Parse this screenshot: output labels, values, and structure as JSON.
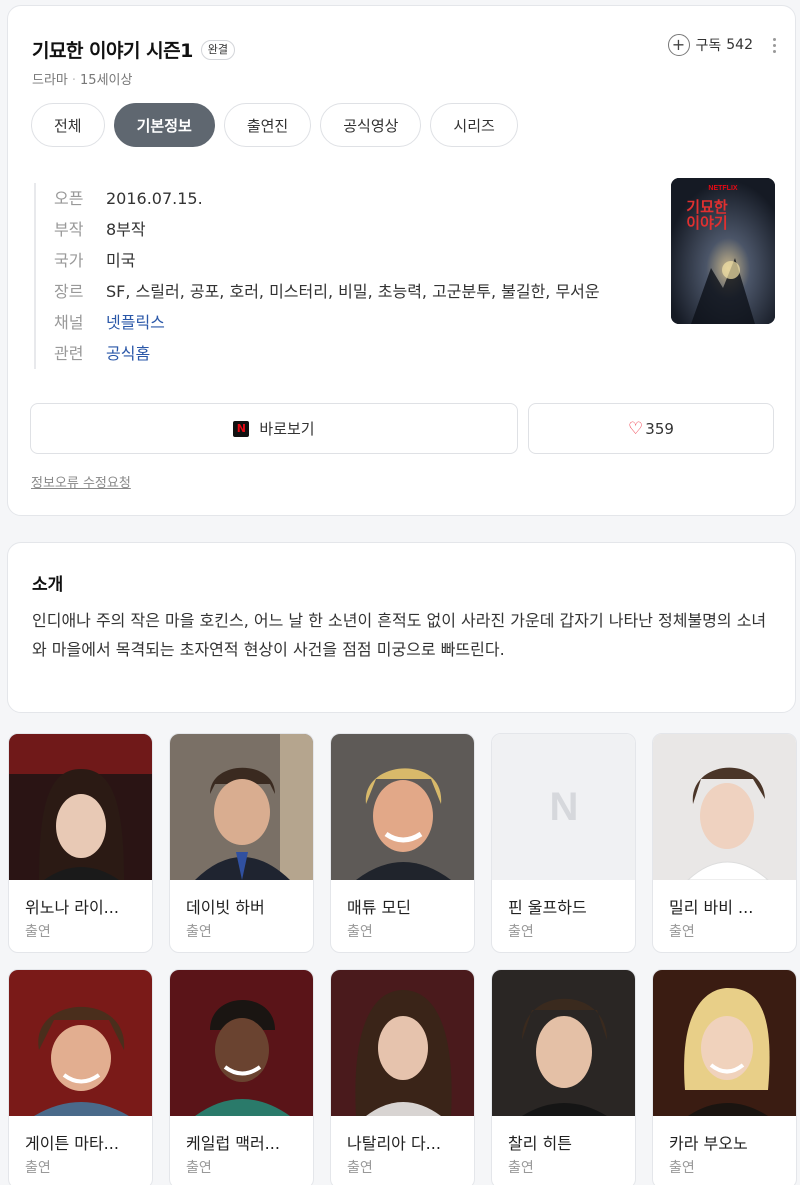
{
  "header": {
    "title": "기묘한 이야기 시즌1",
    "badge": "완결",
    "genre": "드라마",
    "rating": "15세이상",
    "subscribe_label": "구독",
    "subscribe_count": "542"
  },
  "tabs": [
    {
      "label": "전체",
      "active": false
    },
    {
      "label": "기본정보",
      "active": true
    },
    {
      "label": "출연진",
      "active": false
    },
    {
      "label": "공식영상",
      "active": false
    },
    {
      "label": "시리즈",
      "active": false
    }
  ],
  "info": [
    {
      "key": "오픈",
      "value": "2016.07.15."
    },
    {
      "key": "부작",
      "value": "8부작"
    },
    {
      "key": "국가",
      "value": "미국"
    },
    {
      "key": "장르",
      "value": "SF, 스릴러, 공포, 호러, 미스터리, 비밀, 초능력, 고군분투, 불길한, 무서운"
    },
    {
      "key": "채널",
      "value": "넷플릭스"
    },
    {
      "key": "관련",
      "value": "공식홈"
    }
  ],
  "poster": {
    "badge": "NETFLIX",
    "title_line1": "기묘한",
    "title_line2": "이야기"
  },
  "actions": {
    "watch_label": "바로보기",
    "netflix_icon": "N",
    "like_count": "359"
  },
  "report_link": "정보오류 수정요청",
  "intro": {
    "title": "소개",
    "text": "인디애나 주의 작은 마을 호킨스, 어느 날 한 소년이 흔적도 없이 사라진 가운데 갑자기 나타난 정체불명의 소녀와 마을에서 목격되는 초자연적 현상이 사건을 점점 미궁으로 빠뜨린다."
  },
  "cast": [
    {
      "name": "위노나 라이...",
      "role": "출연"
    },
    {
      "name": "데이빗 하버",
      "role": "출연"
    },
    {
      "name": "매튜 모딘",
      "role": "출연"
    },
    {
      "name": "핀 울프하드",
      "role": "출연"
    },
    {
      "name": "밀리 바비 ...",
      "role": "출연"
    },
    {
      "name": "게이튼 마타...",
      "role": "출연"
    },
    {
      "name": "케일럽 맥러...",
      "role": "출연"
    },
    {
      "name": "나탈리아 다...",
      "role": "출연"
    },
    {
      "name": "찰리 히튼",
      "role": "출연"
    },
    {
      "name": "카라 부오노",
      "role": "출연"
    }
  ],
  "colors": {
    "accent_tab": "#5f6770",
    "link": "#2a57a8",
    "heart": "#e34444",
    "netflix_red": "#e50914"
  }
}
